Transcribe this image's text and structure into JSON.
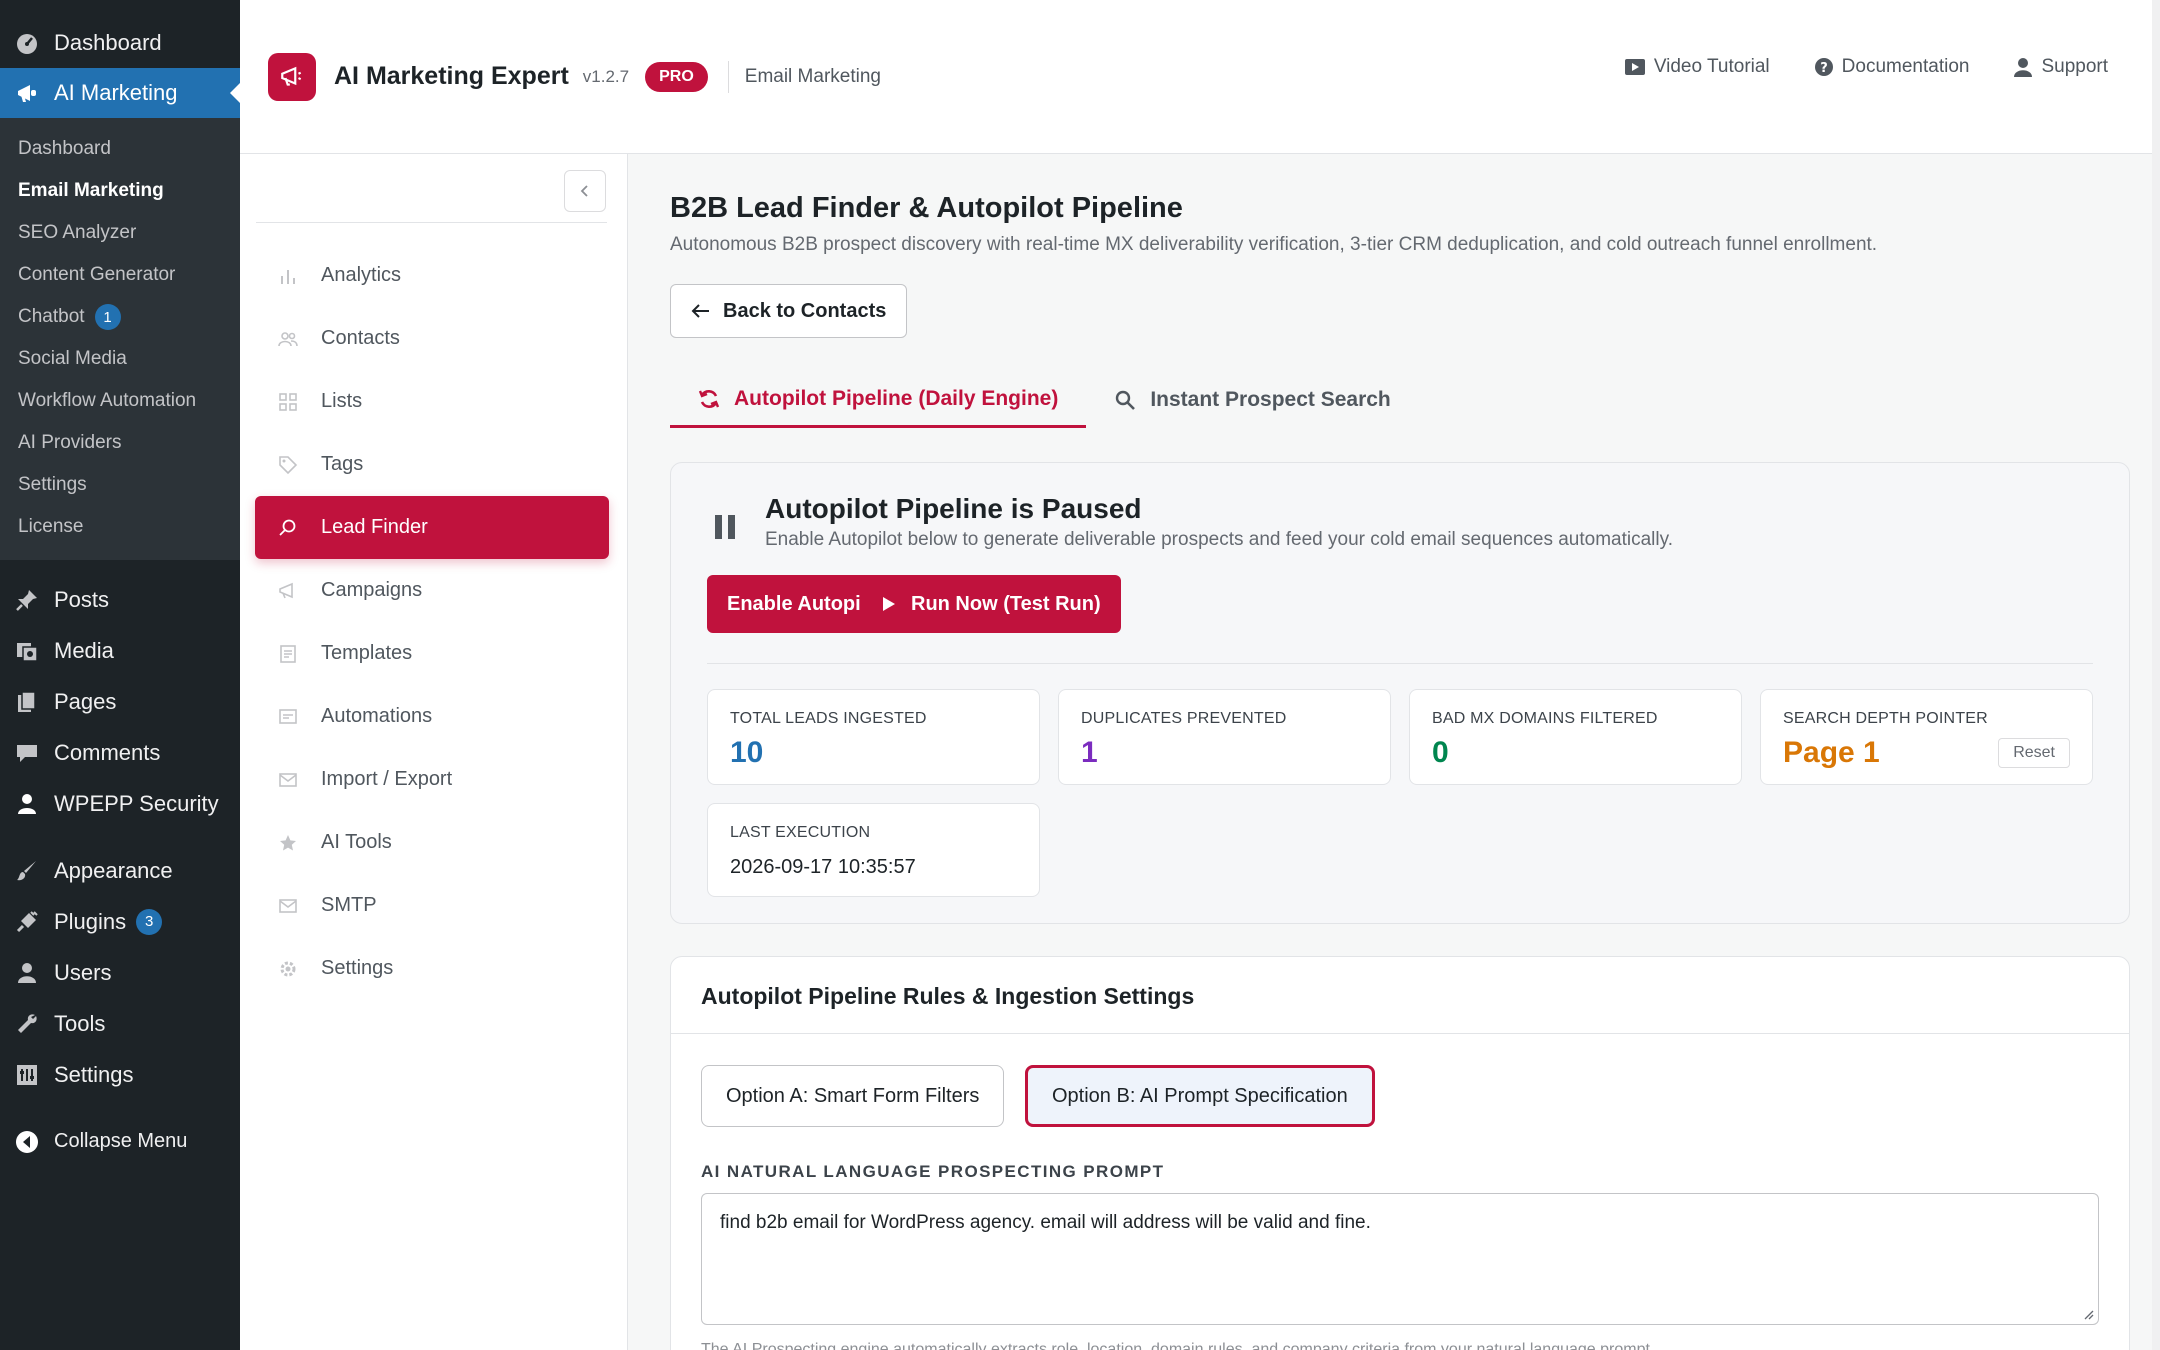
{
  "wp_sidebar": {
    "top_item": "Dashboard",
    "active_item": "AI Marketing",
    "submenu": [
      {
        "label": "Dashboard",
        "current": false
      },
      {
        "label": "Email Marketing",
        "current": true
      },
      {
        "label": "SEO Analyzer",
        "current": false
      },
      {
        "label": "Content Generator",
        "current": false
      },
      {
        "label": "Chatbot",
        "current": false,
        "badge": "1"
      },
      {
        "label": "Social Media",
        "current": false
      },
      {
        "label": "Workflow Automation",
        "current": false
      },
      {
        "label": "AI Providers",
        "current": false
      },
      {
        "label": "Settings",
        "current": false
      },
      {
        "label": "License",
        "current": false
      }
    ],
    "menu": [
      {
        "label": "Posts",
        "icon": "pin-icon"
      },
      {
        "label": "Media",
        "icon": "media-icon"
      },
      {
        "label": "Pages",
        "icon": "pages-icon"
      },
      {
        "label": "Comments",
        "icon": "comment-icon"
      },
      {
        "label": "WPEPP Security",
        "icon": "lock-icon"
      },
      {
        "label": "Appearance",
        "icon": "brush-icon"
      },
      {
        "label": "Plugins",
        "icon": "plug-icon",
        "badge": "3"
      },
      {
        "label": "Users",
        "icon": "user-icon"
      },
      {
        "label": "Tools",
        "icon": "wrench-icon"
      },
      {
        "label": "Settings",
        "icon": "settings-icon"
      }
    ],
    "collapse_label": "Collapse Menu"
  },
  "header": {
    "brand": "AI Marketing Expert",
    "version": "v1.2.7",
    "pro_badge": "PRO",
    "section": "Email Marketing",
    "links": {
      "video": "Video Tutorial",
      "docs": "Documentation",
      "support": "Support"
    }
  },
  "plugin_nav": {
    "items": [
      {
        "label": "Analytics",
        "icon": "bar-chart-icon"
      },
      {
        "label": "Contacts",
        "icon": "users-icon"
      },
      {
        "label": "Lists",
        "icon": "grid-icon"
      },
      {
        "label": "Tags",
        "icon": "tag-icon"
      },
      {
        "label": "Lead Finder",
        "icon": "search-icon",
        "active": true
      },
      {
        "label": "Campaigns",
        "icon": "megaphone-icon"
      },
      {
        "label": "Templates",
        "icon": "document-icon"
      },
      {
        "label": "Automations",
        "icon": "flow-icon"
      },
      {
        "label": "Import / Export",
        "icon": "mail-icon"
      },
      {
        "label": "AI Tools",
        "icon": "star-icon"
      },
      {
        "label": "SMTP",
        "icon": "envelope-icon"
      },
      {
        "label": "Settings",
        "icon": "gear-icon"
      }
    ]
  },
  "main": {
    "title": "B2B Lead Finder & Autopilot Pipeline",
    "subtitle": "Autonomous B2B prospect discovery with real-time MX deliverability verification, 3-tier CRM deduplication, and cold outreach funnel enrollment.",
    "back_button": "Back to Contacts",
    "tabs": [
      {
        "label": "Autopilot Pipeline (Daily Engine)",
        "active": true
      },
      {
        "label": "Instant Prospect Search",
        "active": false
      }
    ]
  },
  "status": {
    "title": "Autopilot Pipeline is Paused",
    "subtitle": "Enable Autopilot below to generate deliverable prospects and feed your cold email sequences automatically.",
    "enable_button": "Enable Autopilot",
    "run_button": "Run Now (Test Run)",
    "stats": {
      "total_leads": {
        "label": "TOTAL LEADS INGESTED",
        "value": "10",
        "color": "#2271b1"
      },
      "duplicates": {
        "label": "DUPLICATES PREVENTED",
        "value": "1",
        "color": "#7b2cbf"
      },
      "bad_mx": {
        "label": "BAD MX DOMAINS FILTERED",
        "value": "0",
        "color": "#00864f"
      },
      "depth": {
        "label": "SEARCH DEPTH POINTER",
        "value": "Page 1",
        "color": "#d97706",
        "reset": "Reset"
      },
      "last_exec": {
        "label": "LAST EXECUTION",
        "value": "2026-09-17 10:35:57"
      }
    }
  },
  "rules": {
    "title": "Autopilot Pipeline Rules & Ingestion Settings",
    "option_a": "Option A: Smart Form Filters",
    "option_b": "Option B: AI Prompt Specification",
    "field_label": "AI NATURAL LANGUAGE PROSPECTING PROMPT",
    "prompt_value": "find b2b email for WordPress agency. email will address will be valid and fine.",
    "help_text": "The AI Prospecting engine automatically extracts role, location, domain rules, and company criteria from your natural language prompt."
  },
  "colors": {
    "accent": "#c0123d",
    "wp_blue": "#2271b1",
    "wp_dark": "#1d2327"
  }
}
